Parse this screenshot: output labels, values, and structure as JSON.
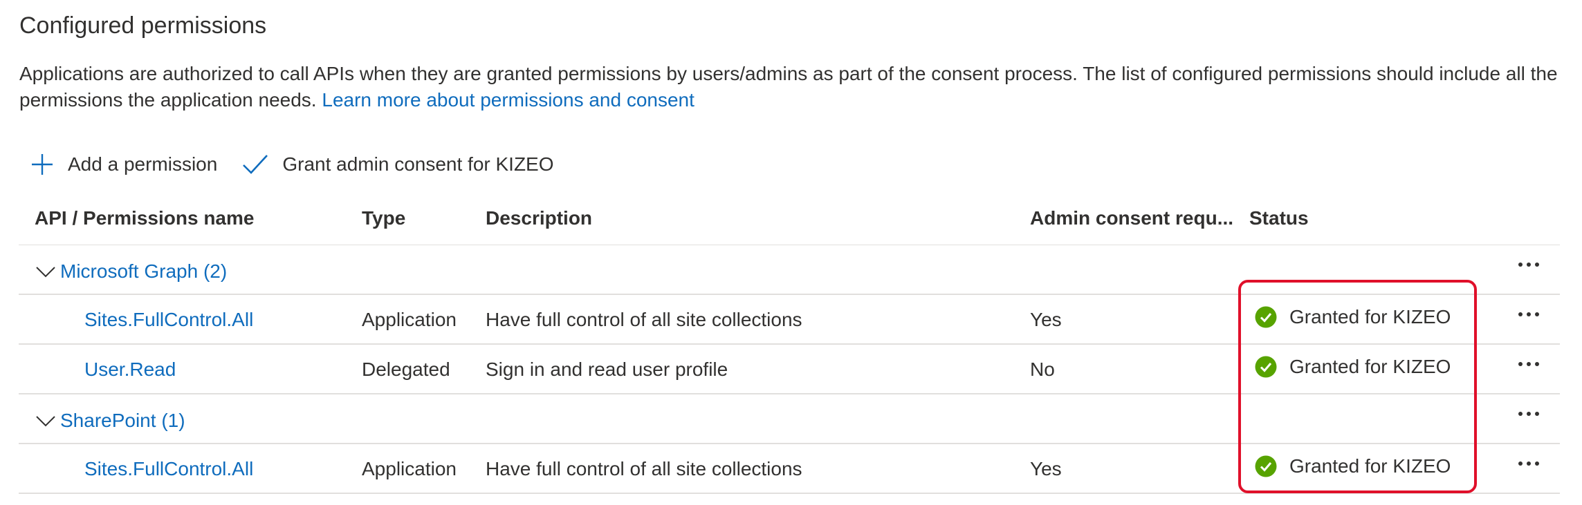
{
  "page": {
    "title": "Configured permissions",
    "description": "Applications are authorized to call APIs when they are granted permissions by users/admins as part of the consent process. The list of configured permissions should include all the permissions the application needs.",
    "learn_more_link": "Learn more about permissions and consent"
  },
  "toolbar": {
    "add_permission_label": "Add a permission",
    "grant_consent_label": "Grant admin consent for KIZEO"
  },
  "table": {
    "columns": {
      "api_name": "API / Permissions name",
      "type": "Type",
      "description": "Description",
      "admin_consent": "Admin consent requ...",
      "status": "Status"
    },
    "groups": [
      {
        "label": "Microsoft Graph (2)",
        "rows": [
          {
            "name": "Sites.FullControl.All",
            "type": "Application",
            "description": "Have full control of all site collections",
            "admin_consent": "Yes",
            "status": "Granted for KIZEO"
          },
          {
            "name": "User.Read",
            "type": "Delegated",
            "description": "Sign in and read user profile",
            "admin_consent": "No",
            "status": "Granted for KIZEO"
          }
        ]
      },
      {
        "label": "SharePoint (1)",
        "rows": [
          {
            "name": "Sites.FullControl.All",
            "type": "Application",
            "description": "Have full control of all site collections",
            "admin_consent": "Yes",
            "status": "Granted for KIZEO"
          }
        ]
      }
    ]
  },
  "icons": {
    "add": "plus-icon",
    "grant": "checkmark-icon",
    "expand": "chevron-down-icon",
    "status": "success-check-circle-icon",
    "more": "more-ellipsis-icon"
  },
  "colors": {
    "link": "#0f6cbd",
    "success": "#57a300",
    "highlight": "#e0102a",
    "text": "#323130"
  }
}
